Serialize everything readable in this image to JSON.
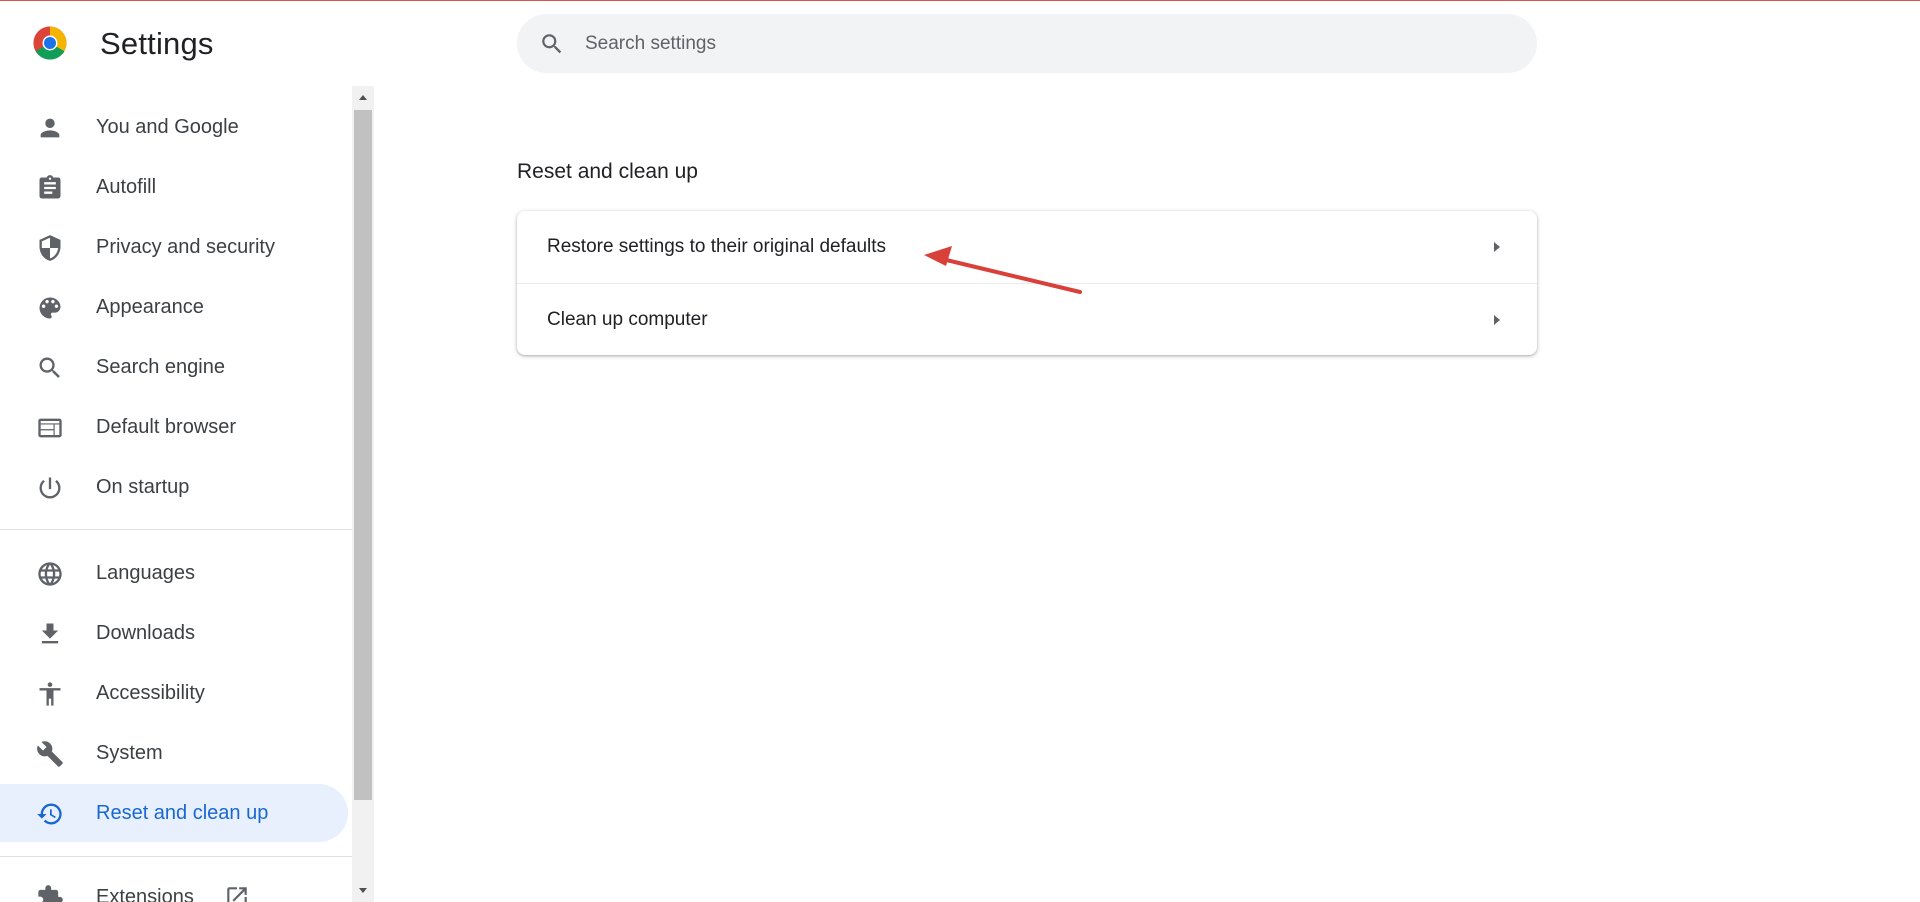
{
  "app": {
    "title": "Settings"
  },
  "search": {
    "placeholder": "Search settings",
    "value": ""
  },
  "sidebar": {
    "items": [
      {
        "label": "You and Google",
        "icon": "person-icon"
      },
      {
        "label": "Autofill",
        "icon": "clipboard-icon"
      },
      {
        "label": "Privacy and security",
        "icon": "shield-icon"
      },
      {
        "label": "Appearance",
        "icon": "palette-icon"
      },
      {
        "label": "Search engine",
        "icon": "search-icon"
      },
      {
        "label": "Default browser",
        "icon": "browser-icon"
      },
      {
        "label": "On startup",
        "icon": "power-icon"
      },
      {
        "label": "Languages",
        "icon": "globe-icon"
      },
      {
        "label": "Downloads",
        "icon": "download-icon"
      },
      {
        "label": "Accessibility",
        "icon": "accessibility-icon"
      },
      {
        "label": "System",
        "icon": "wrench-icon"
      },
      {
        "label": "Reset and clean up",
        "icon": "history-icon",
        "active": true
      },
      {
        "label": "Extensions",
        "icon": "puzzle-icon"
      }
    ]
  },
  "main": {
    "section_title": "Reset and clean up",
    "rows": [
      {
        "label": "Restore settings to their original defaults"
      },
      {
        "label": "Clean up computer"
      }
    ]
  },
  "colors": {
    "accent": "#1967d2",
    "active_bg": "#e8f0fe",
    "icon_gray": "#5f6368",
    "annotation_red": "#d9403a"
  }
}
